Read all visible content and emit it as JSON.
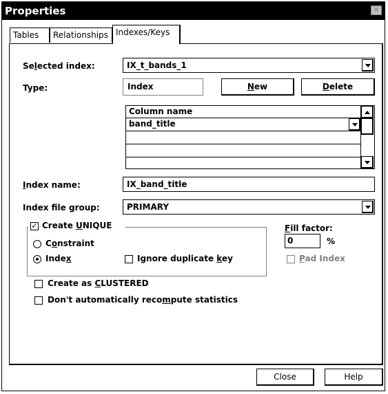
{
  "window": {
    "title": "Properties",
    "close_glyph": "✕"
  },
  "tabs": [
    {
      "label": "Tables",
      "active": false
    },
    {
      "label": "Relationships",
      "active": false
    },
    {
      "label": "Indexes/Keys",
      "active": true
    }
  ],
  "selected_index": {
    "label_pre": "Se",
    "label_u": "l",
    "label_post": "ected index:",
    "value": "IX_t_bands_1"
  },
  "type": {
    "label": "Type:",
    "value": "Index"
  },
  "buttons": {
    "new_pre": "",
    "new_u": "N",
    "new_post": "ew",
    "delete_pre": "",
    "delete_u": "D",
    "delete_post": "elete",
    "close": "Close",
    "help": "Help"
  },
  "columns_grid": {
    "header": "Column name",
    "rows": [
      "band_title",
      "",
      ""
    ]
  },
  "index_name": {
    "label_u": "I",
    "label_post": "ndex name:",
    "value": "IX_band_title"
  },
  "file_group": {
    "label_pre": "Index file ",
    "label_u": "g",
    "label_post": "roup:",
    "value": "PRIMARY"
  },
  "create_unique": {
    "label_pre": "Create ",
    "label_u": "U",
    "label_post": "NIQUE",
    "checked": true,
    "check_glyph": "✓"
  },
  "constraint": {
    "label_pre": "C",
    "label_u": "o",
    "label_post": "nstraint",
    "selected": false
  },
  "index_option": {
    "label_pre": "Inde",
    "label_u": "x",
    "label_post": "",
    "selected": true
  },
  "ignore_dup": {
    "label_pre": "Ignore duplicate ",
    "label_u": "k",
    "label_post": "ey",
    "checked": false
  },
  "fill_factor": {
    "label_u": "F",
    "label_post": "ill factor:",
    "value": "0",
    "unit": "%"
  },
  "pad_index": {
    "label_u": "P",
    "label_post": "ad Index",
    "checked": false,
    "enabled": false
  },
  "clustered": {
    "label_pre": "Create as ",
    "label_u": "C",
    "label_post": "LUSTERED",
    "checked": false
  },
  "recompute": {
    "label_pre": "Don't automatically reco",
    "label_u": "m",
    "label_post": "pute statistics",
    "checked": false
  },
  "icons": {
    "dropdown": "chevron-down-icon",
    "scroll_up": "arrow-up-icon",
    "scroll_down": "arrow-down-icon"
  }
}
